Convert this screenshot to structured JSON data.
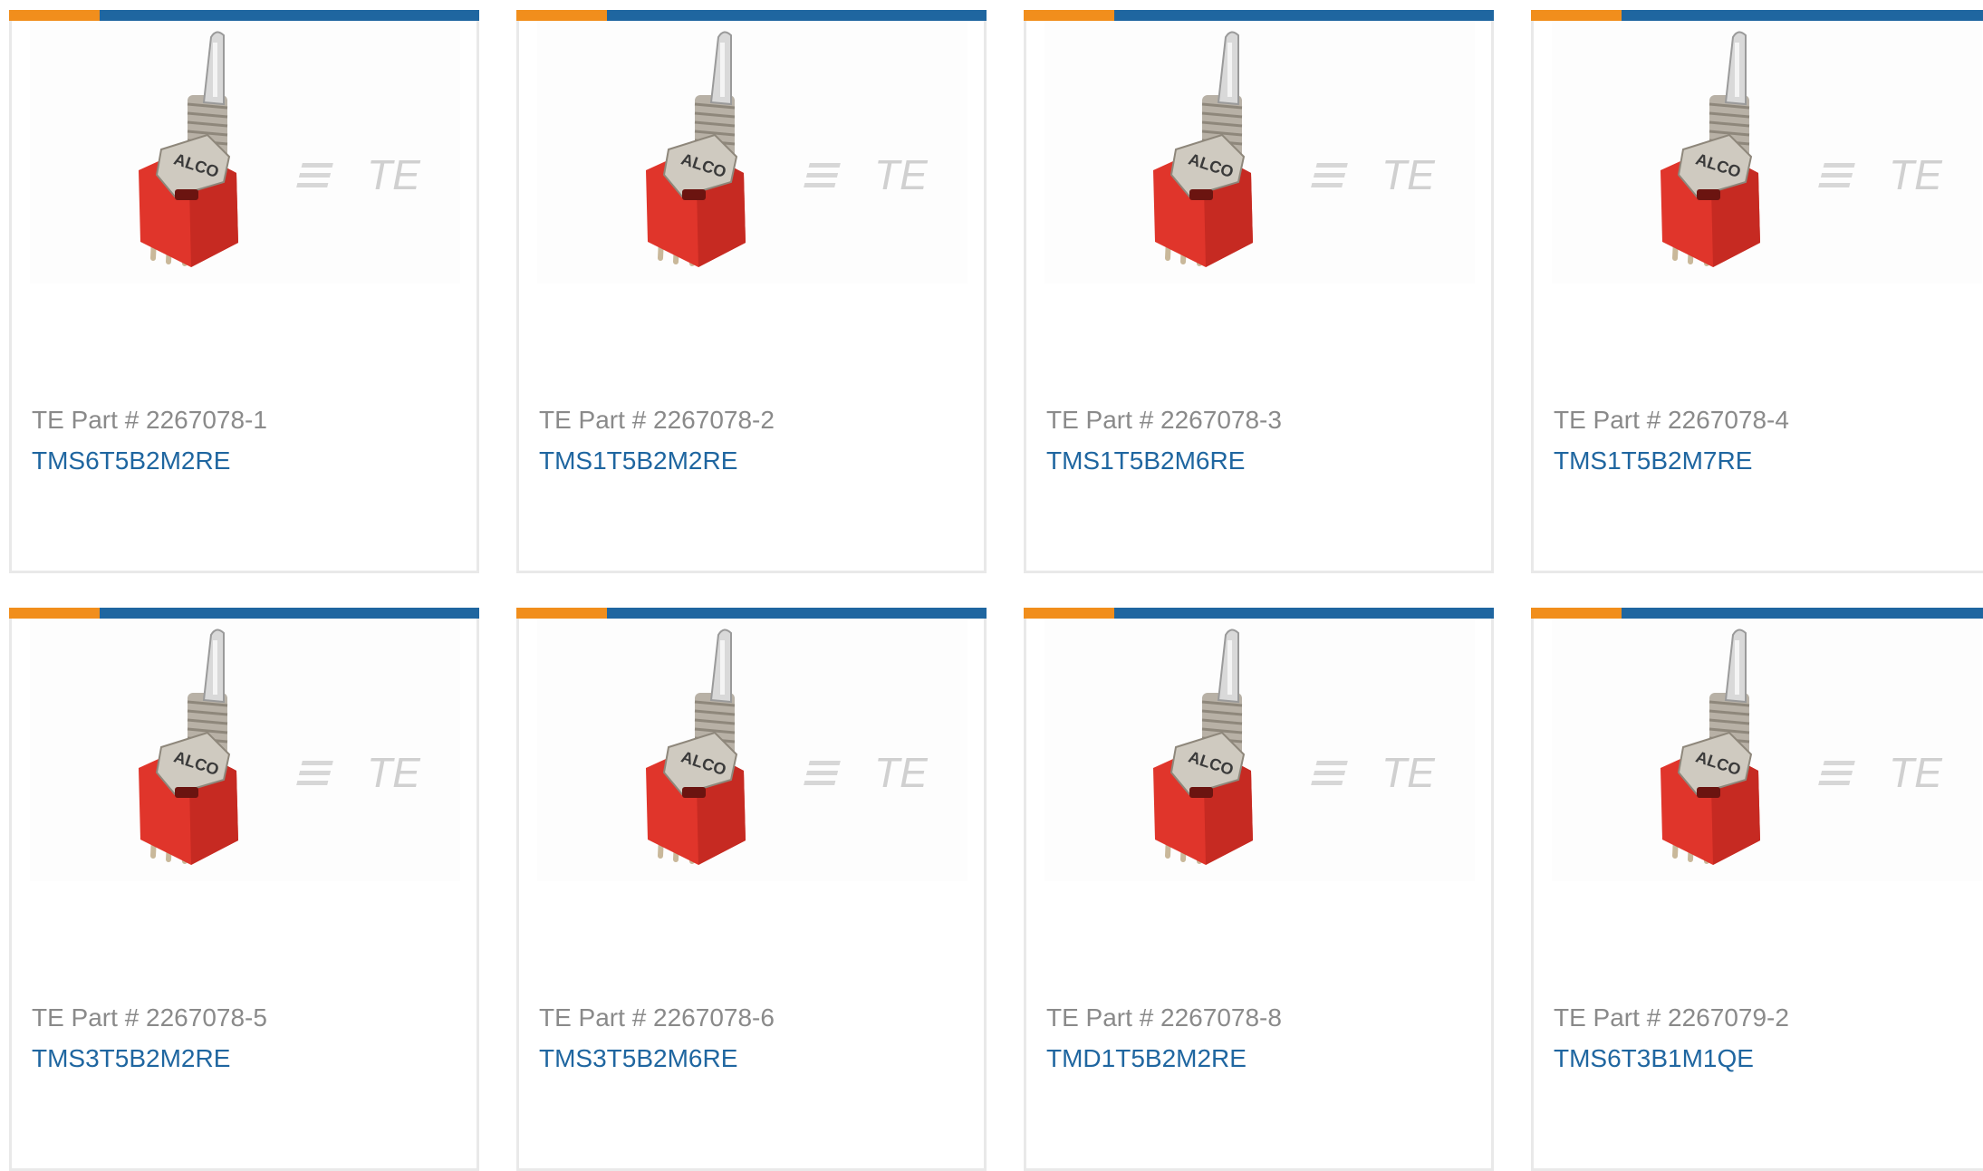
{
  "colors": {
    "accent_orange": "#f18e1c",
    "accent_blue": "#1f66a0",
    "card_border": "#e9e9e9",
    "label_gray": "#8a8a8a"
  },
  "product_image": {
    "icon": "toggle-switch-product-image",
    "switch_brand_text": "ALCO",
    "watermark_logo_text": "TE"
  },
  "products": [
    {
      "part_label": "TE Part # 2267078-1",
      "product_name": "TMS6T5B2M2RE"
    },
    {
      "part_label": "TE Part # 2267078-2",
      "product_name": "TMS1T5B2M2RE"
    },
    {
      "part_label": "TE Part # 2267078-3",
      "product_name": "TMS1T5B2M6RE"
    },
    {
      "part_label": "TE Part # 2267078-4",
      "product_name": "TMS1T5B2M7RE"
    },
    {
      "part_label": "TE Part # 2267078-5",
      "product_name": "TMS3T5B2M2RE"
    },
    {
      "part_label": "TE Part # 2267078-6",
      "product_name": "TMS3T5B2M6RE"
    },
    {
      "part_label": "TE Part # 2267078-8",
      "product_name": "TMD1T5B2M2RE"
    },
    {
      "part_label": "TE Part # 2267079-2",
      "product_name": "TMS6T3B1M1QE"
    }
  ]
}
